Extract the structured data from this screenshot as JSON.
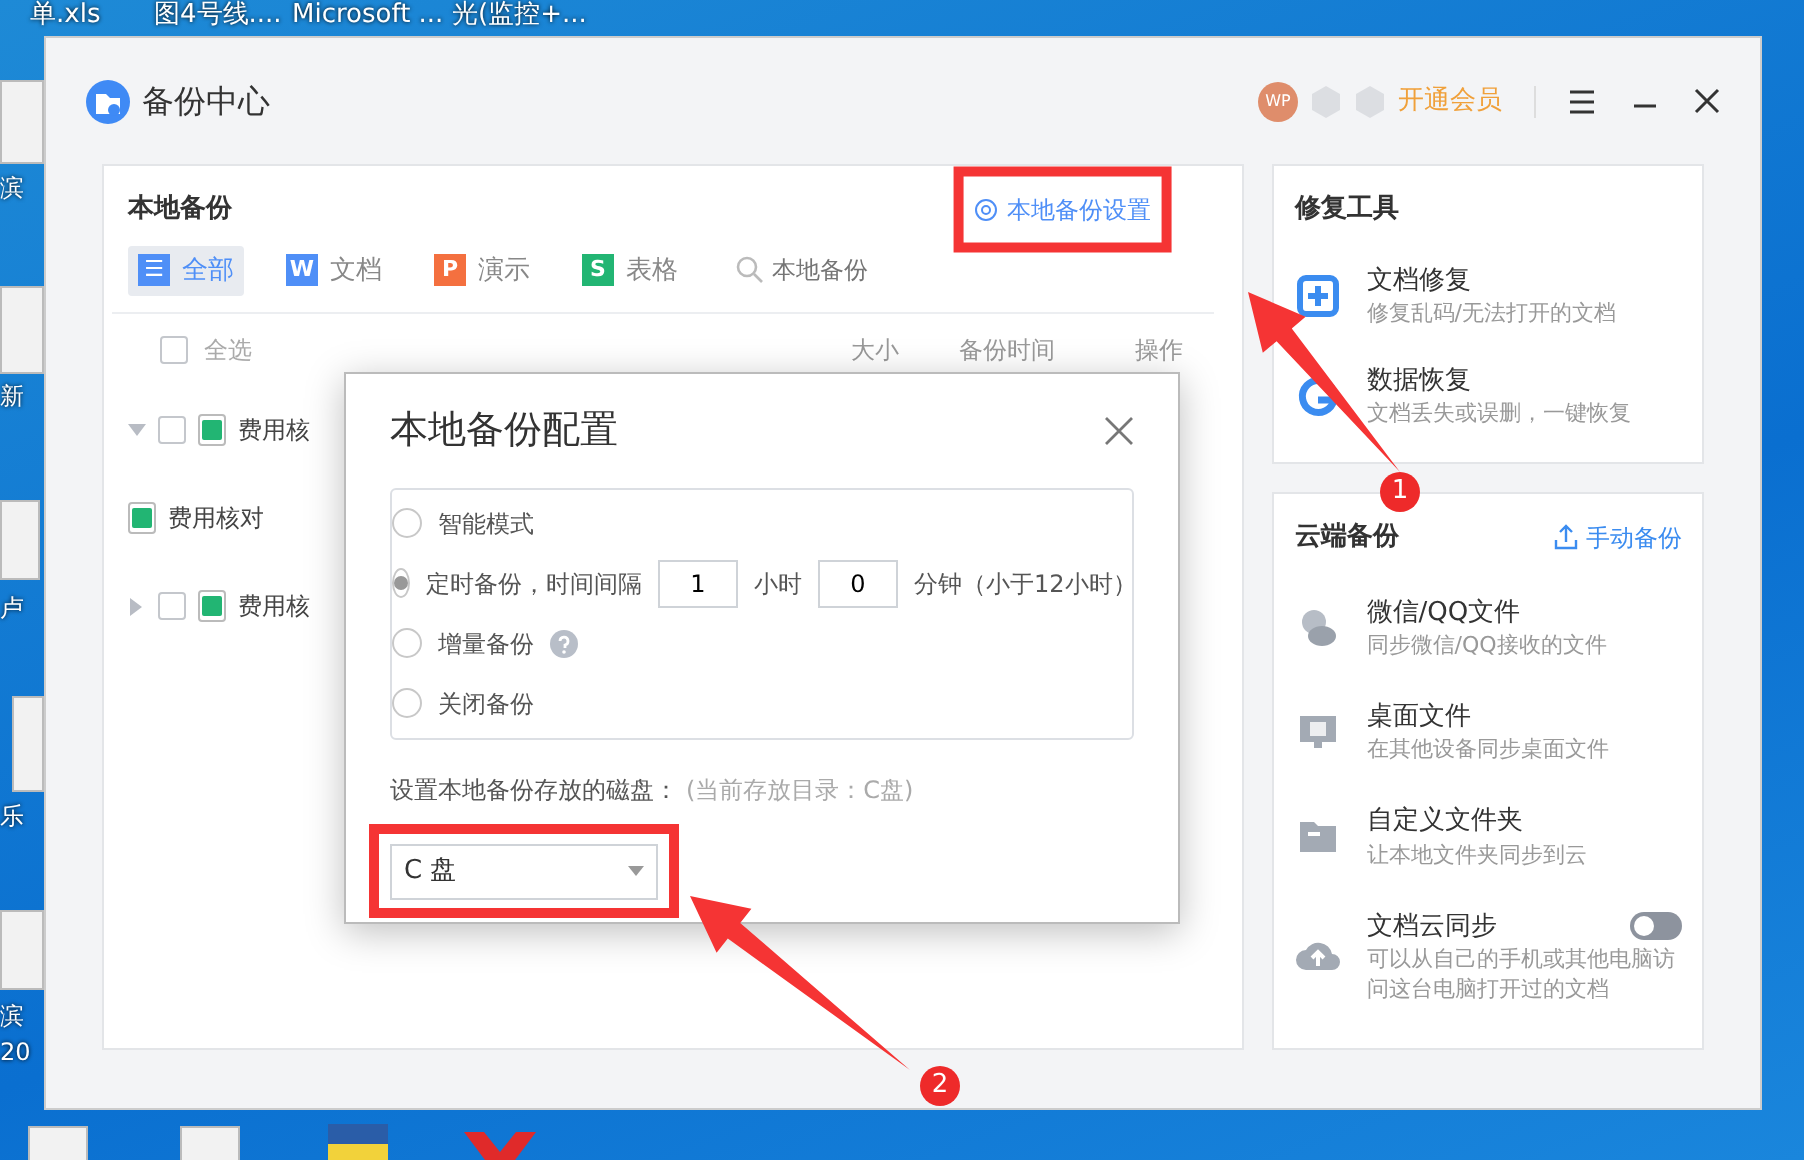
{
  "desktop": {
    "top_labels": [
      "单.xls",
      "图4号线....",
      "Microsoft ...",
      "光(监控+..."
    ],
    "left_labels": [
      "滨",
      "新",
      "卢",
      "乐",
      "滨",
      "20"
    ]
  },
  "window": {
    "title": "备份中心",
    "account": {
      "avatar": "WP",
      "vip_link": "开通会员"
    },
    "local_backup": {
      "title": "本地备份",
      "settings_link": "本地备份设置",
      "filters": [
        {
          "label": "全部",
          "letter": "☰",
          "color": "#4f8ff7",
          "selected": true
        },
        {
          "label": "文档",
          "letter": "W",
          "color": "#4f8ff7",
          "selected": false
        },
        {
          "label": "演示",
          "letter": "P",
          "color": "#f4703f",
          "selected": false
        },
        {
          "label": "表格",
          "letter": "S",
          "color": "#22b573",
          "selected": false
        }
      ],
      "search": {
        "placeholder": "本地备份"
      },
      "table": {
        "select_all": "全选",
        "select_all_checked": false,
        "columns": [
          "大小",
          "备份时间",
          "操作"
        ],
        "rows": [
          {
            "name": "费用核",
            "checked": false,
            "expanded": true,
            "children": [
              {
                "name": "费用核对"
              }
            ]
          },
          {
            "name": "费用核",
            "checked": false,
            "expanded": false
          }
        ]
      }
    },
    "repair_tools": {
      "title": "修复工具",
      "items": [
        {
          "kind": "doc",
          "title": "文档修复",
          "subtitle": "修复乱码/无法打开的文档"
        },
        {
          "kind": "data",
          "title": "数据恢复",
          "subtitle": "文档丢失或误删，一键恢复"
        }
      ]
    },
    "cloud_backup": {
      "title": "云端备份",
      "action": "手动备份",
      "items": [
        {
          "kind": "chat",
          "title": "微信/QQ文件",
          "subtitle": "同步微信/QQ接收的文件"
        },
        {
          "kind": "desktop",
          "title": "桌面文件",
          "subtitle": "在其他设备同步桌面文件"
        },
        {
          "kind": "folder",
          "title": "自定义文件夹",
          "subtitle": "让本地文件夹同步到云"
        },
        {
          "kind": "sync",
          "title": "文档云同步",
          "subtitle": "可以从自己的手机或其他电脑访问这台电脑打开过的文档",
          "on": false
        }
      ]
    }
  },
  "dialog": {
    "title": "本地备份配置",
    "modes": [
      {
        "kind": "plain",
        "label": "智能模式",
        "selected": false
      },
      {
        "kind": "interval",
        "label": "定时备份，时间间隔",
        "selected": true
      },
      {
        "kind": "help",
        "label": "增量备份",
        "selected": false
      },
      {
        "kind": "plain",
        "label": "关闭备份",
        "selected": false
      }
    ],
    "interval": {
      "hours": "1",
      "hour_unit": "小时",
      "minutes": "0",
      "minute_suffix": "分钟（小于12小时）"
    },
    "disk_label": "设置本地备份存放的磁盘：",
    "current_dir": "(当前存放目录：C盘)",
    "disk": "C 盘"
  },
  "annotations": [
    {
      "label": "1"
    },
    {
      "label": "2"
    }
  ]
}
